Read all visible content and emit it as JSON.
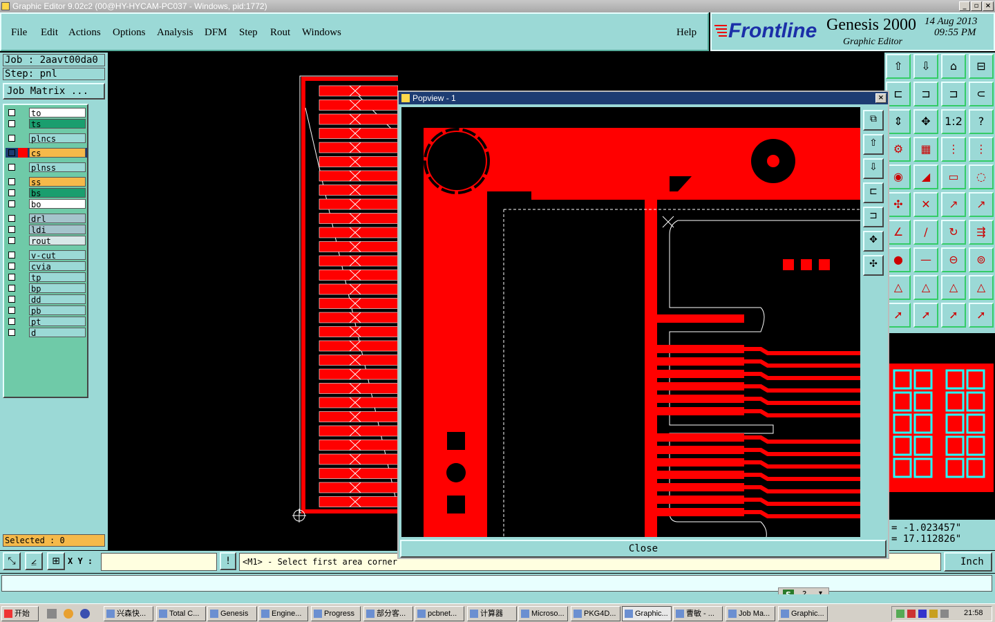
{
  "window": {
    "title": "Graphic Editor 9.02c2 (00@HY-HYCAM-PC037 - Windows, pid:1772)"
  },
  "menu": [
    "File",
    "Edit",
    "Actions",
    "Options",
    "Analysis",
    "DFM",
    "Step",
    "Rout",
    "Windows"
  ],
  "help_label": "Help",
  "brand": {
    "logo": "Frontline",
    "product": "Genesis 2000",
    "subtitle": "Graphic Editor",
    "date": "14 Aug 2013",
    "time": "09:55 PM"
  },
  "job": {
    "job": "Job : 2aavt00da0",
    "step": "Step: pnl",
    "matrix_button": "Job Matrix ..."
  },
  "layers": [
    {
      "name": "to",
      "color": "#ffffff"
    },
    {
      "name": "ts",
      "color": "#1a9e6e"
    },
    {
      "name": "plncs",
      "color": "#9bd9d6"
    },
    {
      "name": "cs",
      "color": "#f5b94a"
    },
    {
      "name": "plnss",
      "color": "#9bd9d6"
    },
    {
      "name": "ss",
      "color": "#f5b94a"
    },
    {
      "name": "bs",
      "color": "#1a9e6e"
    },
    {
      "name": "bo",
      "color": "#ffffff"
    },
    {
      "name": "drl",
      "color": "#a5c4cc"
    },
    {
      "name": "ldi",
      "color": "#a5c4cc"
    },
    {
      "name": "rout",
      "color": "#d8e8e8"
    },
    {
      "name": "v-cut",
      "color": "#9bd9d6"
    },
    {
      "name": "cvia",
      "color": "#9bd9d6"
    },
    {
      "name": "tp",
      "color": "#9bd9d6"
    },
    {
      "name": "bp",
      "color": "#9bd9d6"
    },
    {
      "name": "dd",
      "color": "#9bd9d6"
    },
    {
      "name": "pb",
      "color": "#9bd9d6"
    },
    {
      "name": "pt",
      "color": "#9bd9d6"
    },
    {
      "name": "d",
      "color": "#9bd9d6"
    }
  ],
  "selected_label": "Selected : 0",
  "xy_label": "X Y :",
  "xy_input": "",
  "prompt": "<M1> - Select first area corner",
  "coords": {
    "x": "= -1.023457\"",
    "y": "= 17.112826\""
  },
  "units": "Inch",
  "popview": {
    "title": "Popview - 1",
    "close": "Close"
  },
  "taskbar": {
    "start": "开始",
    "tasks": [
      "兴森快...",
      "Total C...",
      "Genesis",
      "Engine...",
      "Progress",
      "部分客...",
      "pcbnet...",
      "计算器",
      "Microso...",
      "PKG4D...",
      "Graphic...",
      "曹敏 - ...",
      "Job Ma...",
      "Graphic..."
    ],
    "clock": "21:58"
  },
  "colors": {
    "copper": "#ff0000",
    "panel": "#9bd9d6"
  }
}
